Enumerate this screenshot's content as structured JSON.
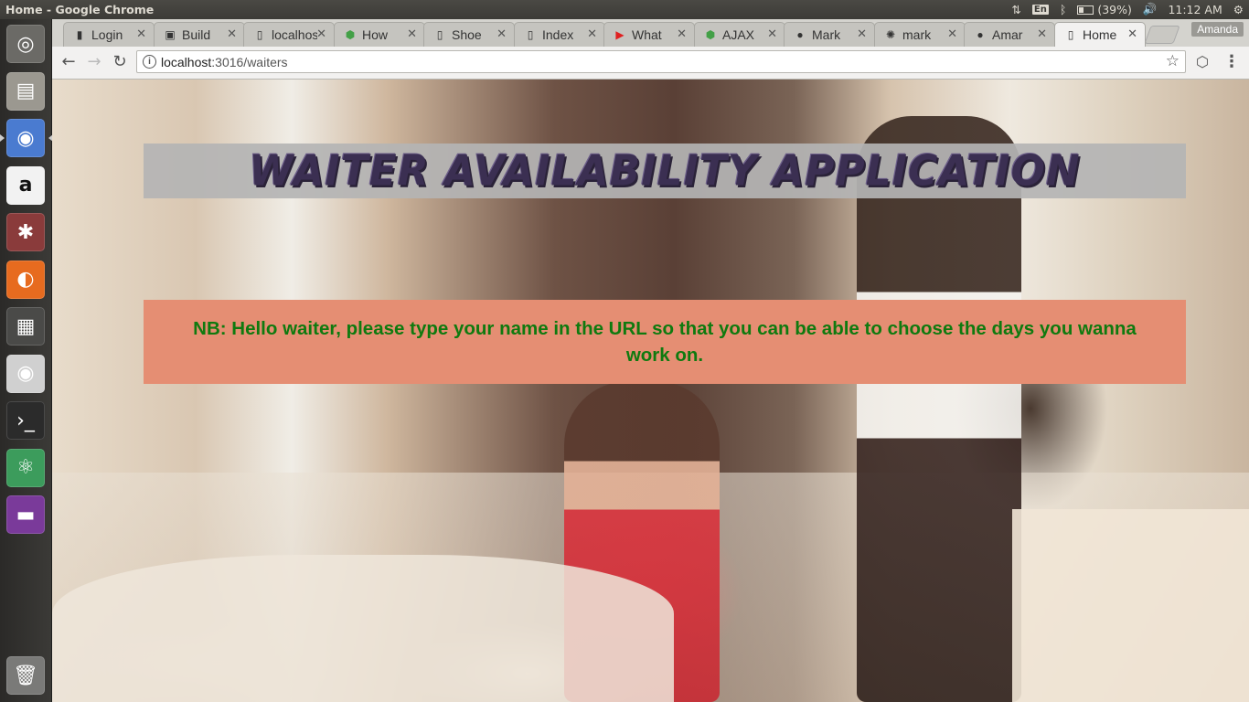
{
  "os_panel": {
    "window_title": "Home - Google Chrome",
    "keyboard_layout": "En",
    "battery": "(39%)",
    "time": "11:12 AM"
  },
  "launcher": {
    "items": [
      {
        "name": "ubuntu-dash-icon",
        "color": "#6b6a66"
      },
      {
        "name": "files-icon",
        "color": "#9b9890"
      },
      {
        "name": "chrome-icon",
        "color": "#4a7bd0"
      },
      {
        "name": "amazon-icon",
        "color": "#f2f2f2"
      },
      {
        "name": "system-settings-icon",
        "color": "#8a3b3b"
      },
      {
        "name": "firefox-icon",
        "color": "#e76b1f"
      },
      {
        "name": "workspace-switcher-icon",
        "color": "#4a4a48"
      },
      {
        "name": "dvd-icon",
        "color": "#d0d0d0"
      },
      {
        "name": "terminal-icon",
        "color": "#2b2b2b"
      },
      {
        "name": "atom-icon",
        "color": "#3c9c5c"
      },
      {
        "name": "purple-app-icon",
        "color": "#7a3a9a"
      },
      {
        "name": "trash-icon",
        "color": "#7a7a78"
      }
    ]
  },
  "browser": {
    "tabs": [
      {
        "title": "Login",
        "icon": "login-favicon",
        "glyph": "▮"
      },
      {
        "title": "Build",
        "icon": "build-favicon",
        "glyph": "▣"
      },
      {
        "title": "localhost",
        "icon": "page-favicon",
        "glyph": "▯"
      },
      {
        "title": "How",
        "icon": "node-favicon",
        "glyph": "⬢"
      },
      {
        "title": "Shoe",
        "icon": "page-favicon",
        "glyph": "▯"
      },
      {
        "title": "Index",
        "icon": "page-favicon",
        "glyph": "▯"
      },
      {
        "title": "What",
        "icon": "youtube-favicon",
        "glyph": "▶"
      },
      {
        "title": "AJAX",
        "icon": "node-favicon",
        "glyph": "⬢"
      },
      {
        "title": "Mark",
        "icon": "github-favicon",
        "glyph": "●"
      },
      {
        "title": "mark",
        "icon": "atom-favicon",
        "glyph": "✺"
      },
      {
        "title": "Amar",
        "icon": "github-favicon",
        "glyph": "●"
      },
      {
        "title": "Home",
        "icon": "page-favicon",
        "glyph": "▯",
        "active": true
      }
    ],
    "profile_name": "Amanda",
    "url_host": "localhost",
    "url_path": ":3016/waiters"
  },
  "page": {
    "heading": "WAITER AVAILABILITY APPLICATION",
    "notice": "NB: Hello waiter, please type your name in the URL so that you can be able to choose the days you wanna work on.",
    "colors": {
      "heading_banner": "#b4b4b4",
      "notice_box": "#e58e73",
      "notice_text": "#0f7a0f"
    }
  }
}
